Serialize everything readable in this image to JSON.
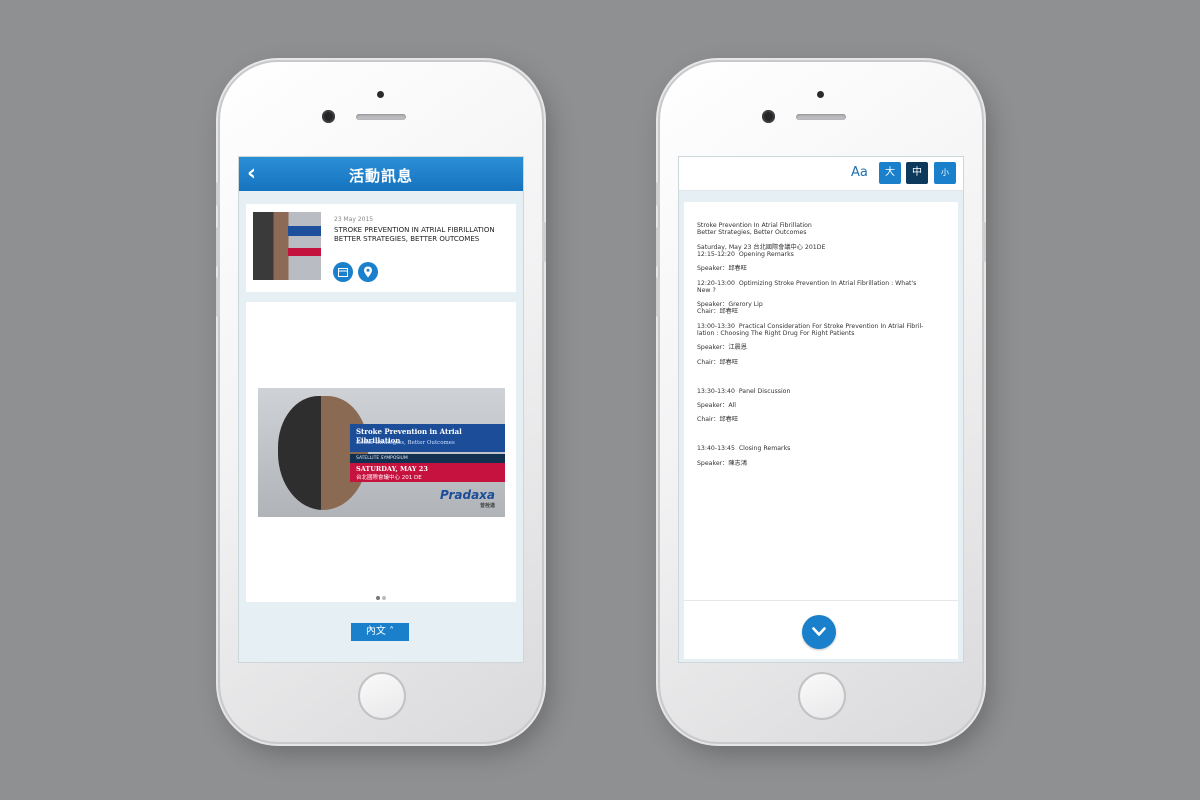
{
  "left": {
    "nav": {
      "back_icon": "chevron-left-icon",
      "back_glyph": "‹",
      "title": "活動訊息"
    },
    "event": {
      "date": "23 May 2015",
      "title_line1": "STROKE PREVENTION IN ATRIAL FIBRILLATION",
      "title_line2": "BETTER STRATEGIES, BETTER OUTCOMES",
      "calendar_icon": "calendar-icon",
      "location_icon": "map-pin-icon"
    },
    "banner": {
      "headline": "Stroke Prevention in Atrial Fibrillation",
      "subhead": "Better Strategies, Better Outcomes",
      "tag": "SATELLITE SYMPOSIUM",
      "date": "SATURDAY, MAY 23",
      "venue": "台北國際會議中心 201 DE",
      "brand": "Pradaxa",
      "brand_sub": "普栓達"
    },
    "pager": {
      "count": 2,
      "active": 1
    },
    "content_button": "內文 ˄"
  },
  "right": {
    "font_label": "Aa",
    "sizes": [
      "大",
      "中",
      "小"
    ],
    "colors": {
      "size_large": "#1a80cc",
      "size_medium": "#0d3a5c",
      "size_small": "#1a80cc"
    },
    "lines": [
      "Stroke Prevention In Atrial Fibrillation",
      "Better Strategies, Better Outcomes",
      "",
      "Saturday, May 23 台北國際會議中心 201DE",
      "12:15-12:20  Opening Remarks",
      "",
      "Speaker：邱春旺",
      "",
      "12:20-13:00  Optimizing Stroke Prevention In Atrial Fibrillation : What's",
      "New ?",
      "",
      "Speaker：Grerory Lip",
      "Chair：邱春旺",
      "",
      "13:00-13:30  Practical Consideration For Stroke Prevention In Atrial Fibril-",
      "lation : Choosing The Right Drug For Right Patients",
      "",
      "Speaker：江晨恩",
      "",
      "Chair：邱春旺",
      "",
      "",
      "",
      "13:30-13:40  Panel Discussion",
      "",
      "Speaker：All",
      "",
      "Chair：邱春旺",
      "",
      "",
      "",
      "13:40-13:45  Closing Remarks",
      "",
      "Speaker：陳志鴻"
    ],
    "scroll_icon": "chevron-down-icon",
    "scroll_glyph": "⌄"
  },
  "colors": {
    "background": "#8f9091",
    "accent": "#1a80cc",
    "nav": "#1673bf"
  }
}
